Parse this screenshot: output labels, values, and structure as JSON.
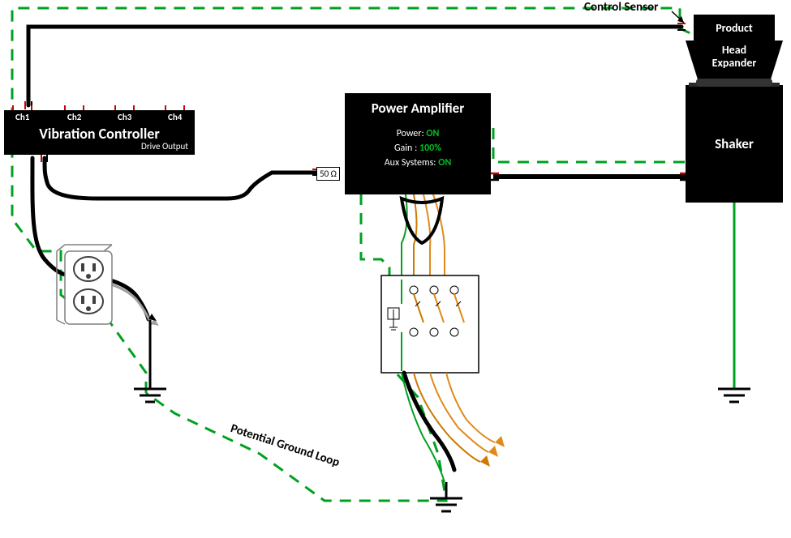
{
  "labels": {
    "control_sensor": "Control Sensor",
    "product": "Product",
    "head_expander_line1": "Head",
    "head_expander_line2": "Expander",
    "shaker": "Shaker",
    "vibration_controller": "Vibration Controller",
    "drive_output": "Drive Output",
    "power_amplifier": "Power Amplifier",
    "power_label": "Power:",
    "power_value": "ON",
    "gain_label": "Gain :",
    "gain_value": "100%",
    "aux_label": "Aux Systems:",
    "aux_value": "ON",
    "impedance": "50 Ω",
    "potential_gl": "Potential Ground Loop",
    "ch1": "Ch1",
    "ch2": "Ch2",
    "ch3": "Ch3",
    "ch4": "Ch4"
  },
  "colors": {
    "loop_green": "#00a020",
    "wire_black": "#000000",
    "wire_red": "#d00000",
    "wire_orange1": "#cc7a00",
    "wire_orange2": "#e08a1a",
    "gray": "#808080"
  },
  "chart_data": {
    "type": "diagram",
    "title": "Vibration test setup ground-loop diagram",
    "components": [
      {
        "id": "vibration_controller",
        "label": "Vibration Controller",
        "ports": [
          "Ch1",
          "Ch2",
          "Ch3",
          "Ch4",
          "Drive Output"
        ]
      },
      {
        "id": "power_amplifier",
        "label": "Power Amplifier",
        "status": {
          "Power": "ON",
          "Gain": "100%",
          "Aux Systems": "ON"
        },
        "input_impedance_ohm": 50
      },
      {
        "id": "shaker",
        "label": "Shaker"
      },
      {
        "id": "head_expander",
        "label": "Head Expander"
      },
      {
        "id": "product",
        "label": "Product"
      },
      {
        "id": "control_sensor",
        "label": "Control Sensor",
        "attached_to": "product"
      },
      {
        "id": "wall_outlet",
        "label": "Wall outlet"
      },
      {
        "id": "three_phase_panel",
        "label": "3-phase breaker panel"
      },
      {
        "id": "ground_A",
        "label": "Earth ground (controller side)"
      },
      {
        "id": "ground_B",
        "label": "Earth ground (amplifier side)"
      },
      {
        "id": "ground_C",
        "label": "Earth ground (shaker side)"
      }
    ],
    "connections": [
      {
        "from": "vibration_controller.Drive Output",
        "to": "power_amplifier.input",
        "kind": "signal_coax"
      },
      {
        "from": "control_sensor",
        "to": "vibration_controller.Ch1",
        "kind": "signal_coax"
      },
      {
        "from": "power_amplifier.output",
        "to": "shaker",
        "kind": "power_pair"
      },
      {
        "from": "vibration_controller",
        "to": "wall_outlet",
        "kind": "mains"
      },
      {
        "from": "wall_outlet",
        "to": "ground_A",
        "kind": "earth"
      },
      {
        "from": "power_amplifier",
        "to": "three_phase_panel",
        "kind": "three_phase"
      },
      {
        "from": "three_phase_panel",
        "to": "ground_B",
        "kind": "earth"
      },
      {
        "from": "shaker",
        "to": "ground_C",
        "kind": "earth"
      }
    ],
    "annotation": {
      "label": "Potential Ground Loop",
      "path_through": [
        "ground_A",
        "vibration_controller",
        "control_sensor",
        "product",
        "shaker",
        "power_amplifier",
        "three_phase_panel",
        "ground_B"
      ]
    }
  }
}
